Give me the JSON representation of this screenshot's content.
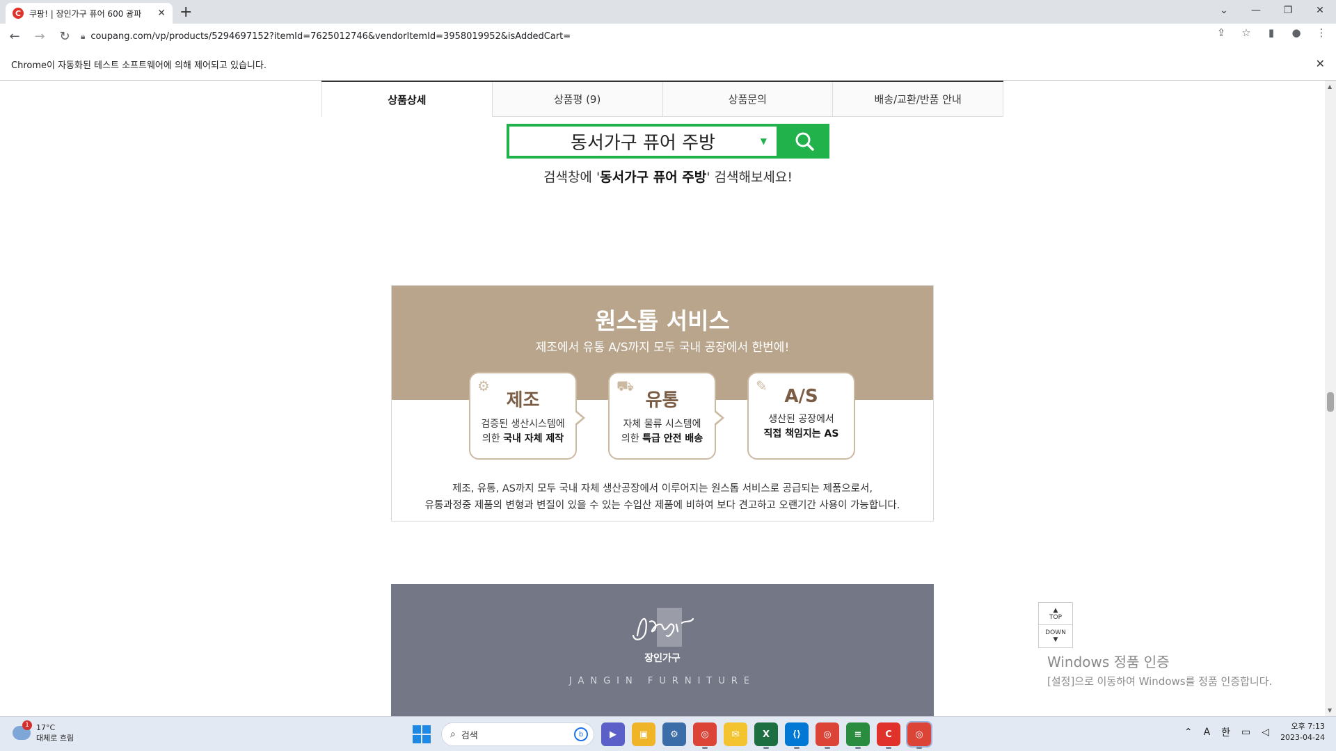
{
  "browser": {
    "tab_title": "쿠팡! | 장인가구 퓨어 600 광파",
    "tab_favicon": "C",
    "url": "coupang.com/vp/products/5294697152?itemId=7625012746&vendorItemId=3958019952&isAddedCart=",
    "infobar_text": "Chrome이 자동화된 테스트 소프트웨어에 의해 제어되고 있습니다."
  },
  "product_tabs": [
    {
      "label": "상품상세"
    },
    {
      "label": "상품평 (9)"
    },
    {
      "label": "상품문의"
    },
    {
      "label": "배송/교환/반품 안내"
    }
  ],
  "search_banner": {
    "keyword": "동서가구 퓨어 주방",
    "hint_prefix": "검색창에 '",
    "hint_keyword": "동서가구 퓨어 주방",
    "hint_suffix": "' 검색해보세요!"
  },
  "onestop": {
    "title": "원스톱 서비스",
    "subtitle": "제조에서 유통 A/S까지 모두 국내 공장에서 한번에!",
    "cards": [
      {
        "title": "제조",
        "line1": "검증된 생산시스템에",
        "line2_plain": "의한 ",
        "line2_bold": "국내 자체 제작",
        "icon": "gear-icon"
      },
      {
        "title": "유통",
        "line1": "자체 물류 시스템에",
        "line2_plain": "의한 ",
        "line2_bold": "특급 안전 배송",
        "icon": "truck-icon"
      },
      {
        "title": "A/S",
        "line1": "생산된 공장에서",
        "line2_plain": "",
        "line2_bold": "직접 책임지는 AS",
        "icon": "wrench-icon"
      }
    ],
    "desc1": "제조, 유통, AS까지 모두 국내 자체 생산공장에서 이루어지는 원스톱 서비스로 공급되는 제품으로서,",
    "desc2": "유통과정중 제품의 변형과 변질이 있을 수 있는 수입산 제품에 비하여 보다 견고하고 오랜기간 사용이 가능합니다.",
    "color_bg": "#b8a58c"
  },
  "brand": {
    "name_ko": "장인가구",
    "name_en": "JANGIN FURNITURE",
    "color_bg": "#737786"
  },
  "floating_nav": {
    "top": "TOP",
    "down": "DOWN"
  },
  "watermark": {
    "title": "Windows 정품 인증",
    "subtitle": "[설정]으로 이동하여 Windows를 정품 인증합니다."
  },
  "taskbar": {
    "weather_temp": "17°C",
    "weather_desc": "대체로 흐림",
    "weather_badge": "1",
    "search_placeholder": "검색",
    "tray_ime_a": "A",
    "tray_ime_han": "한",
    "clock_time": "오후 7:13",
    "clock_date": "2023-04-24"
  }
}
